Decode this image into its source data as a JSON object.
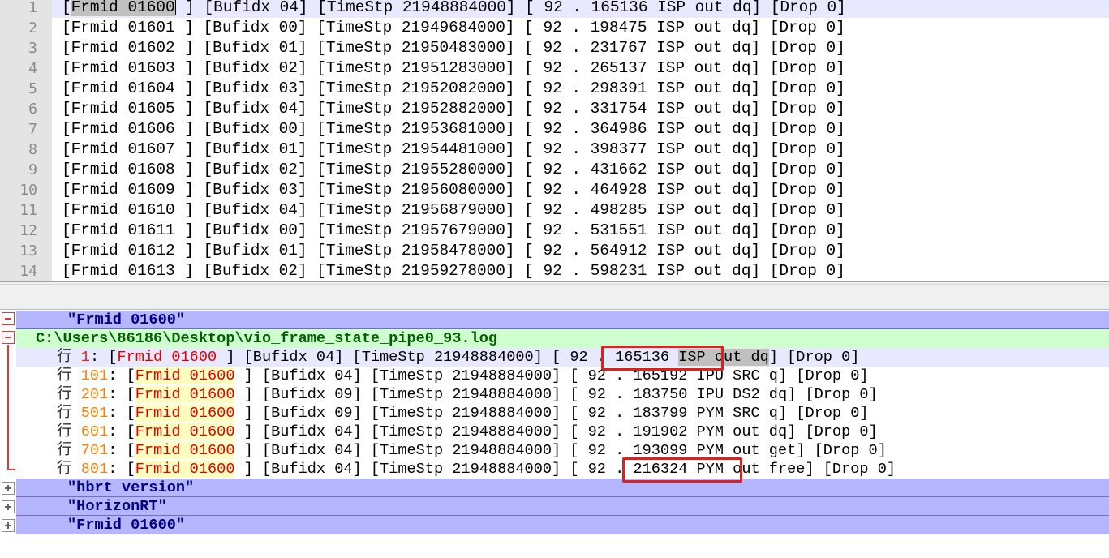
{
  "editor": {
    "lines": [
      {
        "num": "1",
        "frm": "01600",
        "buf": "04",
        "ts": "21948884000",
        "sec": "92",
        "usec": "165136",
        "evt": "ISP out dq",
        "drop": "0"
      },
      {
        "num": "2",
        "frm": "01601",
        "buf": "00",
        "ts": "21949684000",
        "sec": "92",
        "usec": "198475",
        "evt": "ISP out dq",
        "drop": "0"
      },
      {
        "num": "3",
        "frm": "01602",
        "buf": "01",
        "ts": "21950483000",
        "sec": "92",
        "usec": "231767",
        "evt": "ISP out dq",
        "drop": "0"
      },
      {
        "num": "4",
        "frm": "01603",
        "buf": "02",
        "ts": "21951283000",
        "sec": "92",
        "usec": "265137",
        "evt": "ISP out dq",
        "drop": "0"
      },
      {
        "num": "5",
        "frm": "01604",
        "buf": "03",
        "ts": "21952082000",
        "sec": "92",
        "usec": "298391",
        "evt": "ISP out dq",
        "drop": "0"
      },
      {
        "num": "6",
        "frm": "01605",
        "buf": "04",
        "ts": "21952882000",
        "sec": "92",
        "usec": "331754",
        "evt": "ISP out dq",
        "drop": "0"
      },
      {
        "num": "7",
        "frm": "01606",
        "buf": "00",
        "ts": "21953681000",
        "sec": "92",
        "usec": "364986",
        "evt": "ISP out dq",
        "drop": "0"
      },
      {
        "num": "8",
        "frm": "01607",
        "buf": "01",
        "ts": "21954481000",
        "sec": "92",
        "usec": "398377",
        "evt": "ISP out dq",
        "drop": "0"
      },
      {
        "num": "9",
        "frm": "01608",
        "buf": "02",
        "ts": "21955280000",
        "sec": "92",
        "usec": "431662",
        "evt": "ISP out dq",
        "drop": "0"
      },
      {
        "num": "10",
        "frm": "01609",
        "buf": "03",
        "ts": "21956080000",
        "sec": "92",
        "usec": "464928",
        "evt": "ISP out dq",
        "drop": "0"
      },
      {
        "num": "11",
        "frm": "01610",
        "buf": "04",
        "ts": "21956879000",
        "sec": "92",
        "usec": "498285",
        "evt": "ISP out dq",
        "drop": "0"
      },
      {
        "num": "12",
        "frm": "01611",
        "buf": "00",
        "ts": "21957679000",
        "sec": "92",
        "usec": "531551",
        "evt": "ISP out dq",
        "drop": "0"
      },
      {
        "num": "13",
        "frm": "01612",
        "buf": "01",
        "ts": "21958478000",
        "sec": "92",
        "usec": "564912",
        "evt": "ISP out dq",
        "drop": "0"
      },
      {
        "num": "14",
        "frm": "01613",
        "buf": "02",
        "ts": "21959278000",
        "sec": "92",
        "usec": "598231",
        "evt": "ISP out dq",
        "drop": "0"
      }
    ]
  },
  "results": {
    "search1": "\"Frmid 01600\"",
    "file_path": "C:\\Users\\86186\\Desktop\\vio_frame_state_pipe0_93.log",
    "line_prefix": "行",
    "hits": [
      {
        "ln": "1",
        "pad": "",
        "match": "Frmid 01600",
        "buf": "04",
        "ts": "21948884000",
        "sec": "92",
        "usec": "165136",
        "evt": "ISP out dq",
        "drop": "0"
      },
      {
        "ln": "101",
        "pad": "",
        "match": "Frmid 01600",
        "buf": "04",
        "ts": "21948884000",
        "sec": "92",
        "usec": "165192",
        "evt": "IPU SRC q",
        "drop": "0"
      },
      {
        "ln": "201",
        "pad": "",
        "match": "Frmid 01600",
        "buf": "09",
        "ts": "21948884000",
        "sec": "92",
        "usec": "183750",
        "evt": "IPU DS2 dq",
        "drop": "0"
      },
      {
        "ln": "501",
        "pad": "",
        "match": "Frmid 01600",
        "buf": "09",
        "ts": "21948884000",
        "sec": "92",
        "usec": "183799",
        "evt": "PYM SRC q",
        "drop": "0"
      },
      {
        "ln": "601",
        "pad": "",
        "match": "Frmid 01600",
        "buf": "04",
        "ts": "21948884000",
        "sec": "92",
        "usec": "191902",
        "evt": "PYM out dq",
        "drop": "0"
      },
      {
        "ln": "701",
        "pad": "",
        "match": "Frmid 01600",
        "buf": "04",
        "ts": "21948884000",
        "sec": "92",
        "usec": "193099",
        "evt": "PYM out get",
        "drop": "0"
      },
      {
        "ln": "801",
        "pad": "",
        "match": "Frmid 01600",
        "buf": "04",
        "ts": "21948884000",
        "sec": "92",
        "usec": "216324",
        "evt": "PYM out free",
        "drop": "0"
      }
    ],
    "search2": "\"hbrt version\"",
    "search3": "\"HorizonRT\"",
    "search4": "\"Frmid 01600\""
  },
  "colors": {
    "search_header_bg": "#b6b6ff",
    "file_header_bg": "#cfffcf",
    "match_text": "#e00000",
    "match_bg": "#ffffc0",
    "line_number": "#ff8000",
    "highlight_box": "#e02020"
  }
}
